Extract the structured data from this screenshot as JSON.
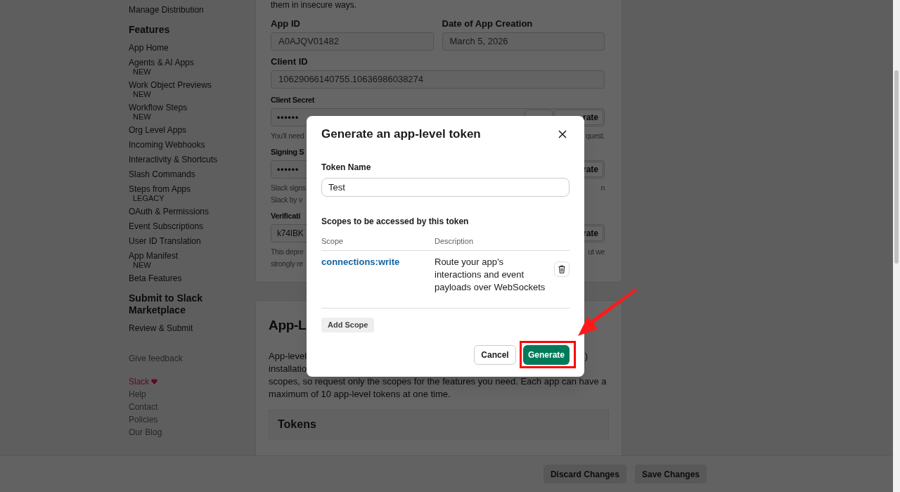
{
  "sidebar": {
    "items": [
      {
        "kind": "link",
        "label": "Manage Distribution"
      },
      {
        "kind": "heading",
        "label": "Features"
      },
      {
        "kind": "link",
        "label": "App Home"
      },
      {
        "kind": "link",
        "label": "Agents & AI Apps",
        "badge": "NEW"
      },
      {
        "kind": "link",
        "label": "Work Object Previews",
        "badge": "NEW"
      },
      {
        "kind": "link",
        "label": "Workflow Steps",
        "badge": "NEW"
      },
      {
        "kind": "link",
        "label": "Org Level Apps"
      },
      {
        "kind": "link",
        "label": "Incoming Webhooks"
      },
      {
        "kind": "link",
        "label": "Interactivity & Shortcuts"
      },
      {
        "kind": "link",
        "label": "Slash Commands"
      },
      {
        "kind": "link",
        "label": "Steps from Apps",
        "badge": "LEGACY"
      },
      {
        "kind": "link",
        "label": "OAuth & Permissions"
      },
      {
        "kind": "link",
        "label": "Event Subscriptions"
      },
      {
        "kind": "link",
        "label": "User ID Translation"
      },
      {
        "kind": "link",
        "label": "App Manifest",
        "badge": "NEW"
      },
      {
        "kind": "link",
        "label": "Beta Features"
      },
      {
        "kind": "heading",
        "label": "Submit to Slack Marketplace"
      },
      {
        "kind": "link",
        "label": "Review & Submit"
      }
    ],
    "feedback": "Give feedback",
    "footer_links": [
      {
        "kind": "brand",
        "label": "Slack"
      },
      {
        "kind": "link",
        "label": "Help"
      },
      {
        "kind": "link",
        "label": "Contact"
      },
      {
        "kind": "link",
        "label": "Policies"
      },
      {
        "kind": "link",
        "label": "Our Blog"
      }
    ]
  },
  "credentials": {
    "intro": "them in insecure ways.",
    "app_id": {
      "label": "App ID",
      "value": "A0AJQV01482"
    },
    "date": {
      "label": "Date of App Creation",
      "value": "March 5, 2026"
    },
    "client_id": {
      "label": "Client ID",
      "value": "10629066140755.10636986038274"
    },
    "secrets": [
      {
        "label": "Client Secret",
        "value": "••••••",
        "masked": true,
        "action": "rate",
        "note_lines": [
          {
            "left": "You'll need",
            "right": "quest."
          }
        ]
      },
      {
        "label": "Signing S",
        "value": "••••••",
        "masked": true,
        "action": "rate",
        "note_lines": [
          {
            "left": "Slack signs",
            "right": "n"
          },
          {
            "left": "Slack by v"
          }
        ]
      },
      {
        "label": "Verificati",
        "value": "k74IBK",
        "masked": false,
        "action": "rate",
        "note_lines": [
          {
            "left": "This depre",
            "right": "ut we"
          },
          {
            "left": "strongly re"
          }
        ]
      }
    ]
  },
  "app_level_tokens": {
    "heading": "App-L",
    "lines": [
      {
        "left": "App-level",
        "right": ")"
      },
      {
        "left": "installatio"
      },
      {
        "left": "scopes, so request only the scopes for the features you need. Each app can have a"
      },
      {
        "left": "maximum of 10 app-level tokens at one time."
      }
    ],
    "tokens_heading": "Tokens"
  },
  "modal": {
    "title": "Generate an app-level token",
    "token_name_label": "Token Name",
    "token_name": "Test",
    "scopes_heading": "Scopes to be accessed by this token",
    "columns": [
      "Scope",
      "Description"
    ],
    "scopes": [
      {
        "scope": "connections:write",
        "description": "Route your app’s interactions and event payloads over WebSockets"
      }
    ],
    "add_scope": "Add Scope",
    "cancel": "Cancel",
    "generate": "Generate"
  },
  "footer_bar": {
    "buttons": [
      "Discard Changes",
      "Save Changes"
    ]
  }
}
